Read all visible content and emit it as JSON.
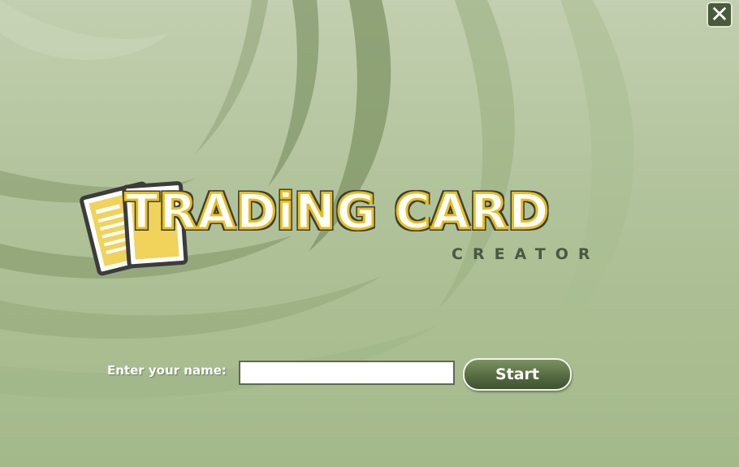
{
  "window": {
    "close_icon": "close-icon"
  },
  "logo": {
    "title": "TRADiNG CARD",
    "subtitle": "CREATOR",
    "icon": "trading-cards-icon"
  },
  "form": {
    "name_label": "Enter your name:",
    "name_value": "",
    "name_placeholder": "",
    "start_label": "Start"
  },
  "colors": {
    "background": "#b4c59e",
    "swirl_dark": "#7f9466",
    "logo_fill": "#ffffff",
    "logo_outline": "#e8bf1a",
    "logo_shadow": "#3c3c3c",
    "subtitle": "#4a5840",
    "button": "#566b41"
  }
}
